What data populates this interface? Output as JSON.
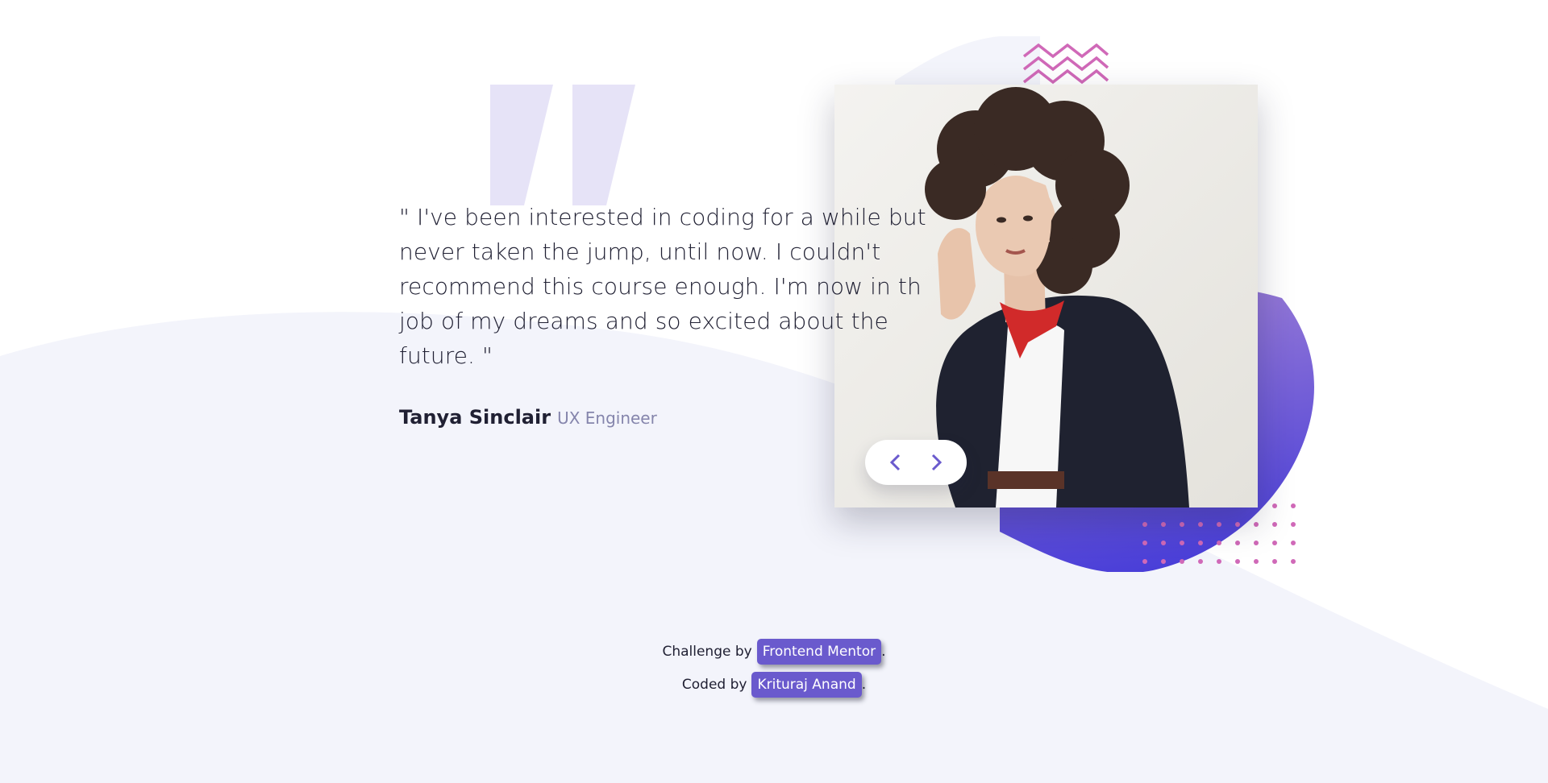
{
  "testimonial": {
    "quote": "\" I've been interested in coding for a while but never taken the jump, until now. I couldn't recommend this course enough. I'm now in th job of my dreams and so excited about the future. \"",
    "author_name": "Tanya Sinclair",
    "author_role": "UX Engineer"
  },
  "navigation": {
    "prev_icon": "chevron-left-icon",
    "next_icon": "chevron-right-icon"
  },
  "footer": {
    "challenge_prefix": "Challenge by",
    "challenge_link": "Frontend Mentor",
    "challenge_suffix": ".",
    "coded_prefix": "Coded by",
    "coded_link": "Krituraj Anand",
    "coded_suffix": "."
  },
  "colors": {
    "background": "#ffffff",
    "curve": "#f3f4fb",
    "accent": "#6a5acd",
    "blob_start": "#9d7fd6",
    "blob_end": "#4a3fd8",
    "pattern_pink": "#d069b8",
    "text_dark": "#202033",
    "text_muted": "#8585ac"
  }
}
